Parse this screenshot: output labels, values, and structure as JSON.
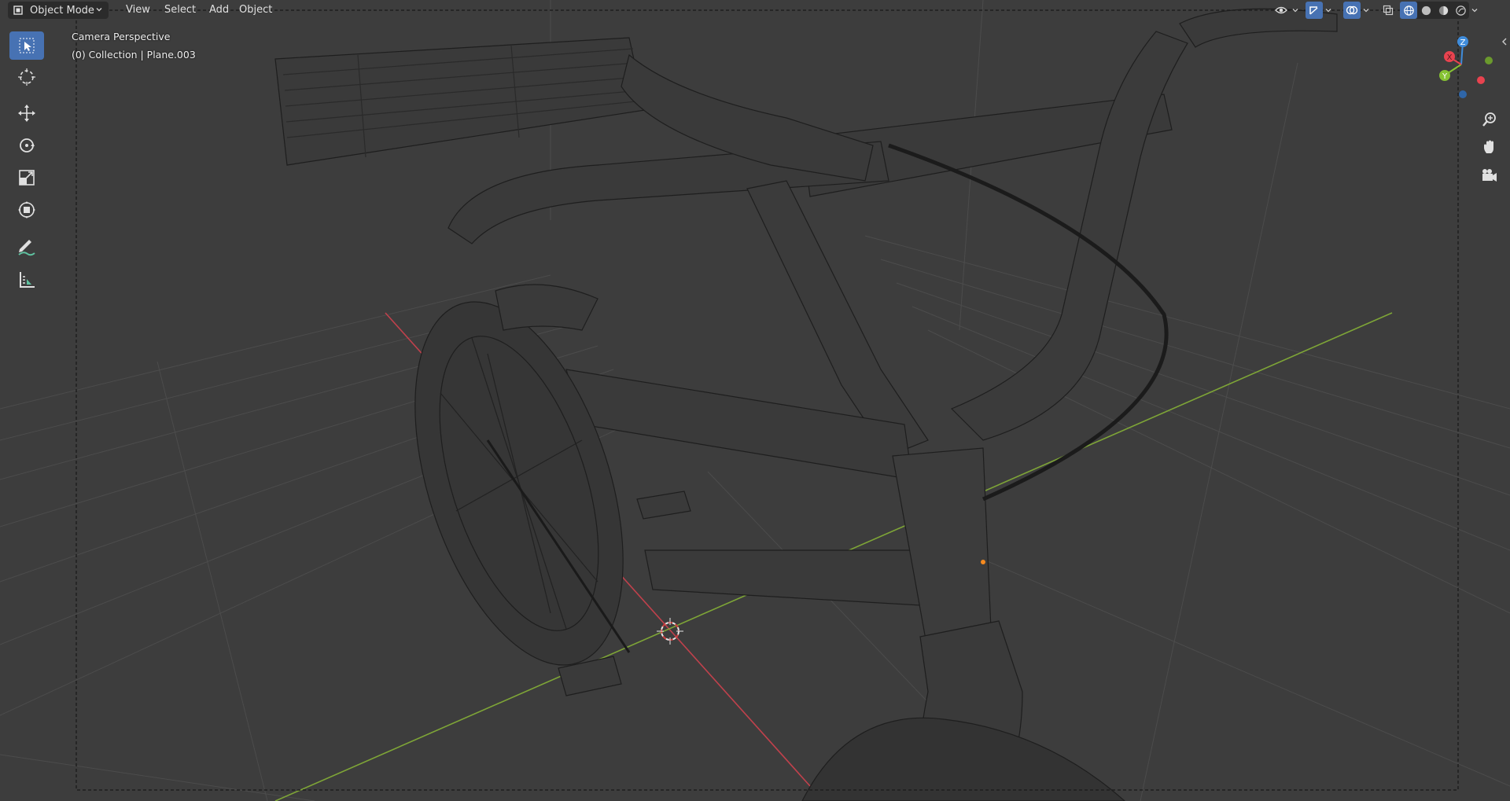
{
  "header": {
    "mode": "Object Mode",
    "menus": [
      "View",
      "Select",
      "Add",
      "Object"
    ],
    "icons": [
      "visibility-icon",
      "gizmo-icon",
      "overlay-icon",
      "xray-icon",
      "wireframe-shading-icon",
      "solid-shading-icon",
      "material-shading-icon",
      "rendered-shading-icon"
    ]
  },
  "toolbar": {
    "tools": [
      "select-box-icon",
      "cursor-icon",
      "move-icon",
      "rotate-icon",
      "scale-icon",
      "transform-icon",
      "annotate-icon",
      "measure-icon"
    ],
    "active": "select-box-icon"
  },
  "viewport": {
    "view_name": "Camera Perspective",
    "collection_info": "(0) Collection | Plane.003"
  },
  "gizmo": {
    "axes": [
      "X",
      "Y",
      "Z"
    ],
    "colors": {
      "x": "#e8434f",
      "y": "#86c233",
      "z": "#3f8cdb",
      "accent": "#4772b3"
    }
  },
  "navigation": [
    "zoom-icon",
    "pan-hand-icon",
    "camera-view-icon"
  ]
}
